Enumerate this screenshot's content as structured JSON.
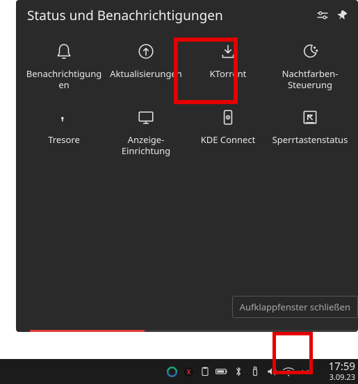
{
  "panel": {
    "title": "Status und Benachrichtigungen",
    "items": [
      {
        "label": "Benachrichtigungen",
        "name": "tile-notifications",
        "icon": "bell-icon"
      },
      {
        "label": "Aktualisierungen",
        "name": "tile-updates",
        "icon": "update-icon"
      },
      {
        "label": "KTorrent",
        "name": "tile-ktorrent",
        "icon": "download-icon"
      },
      {
        "label": "Nachtfarben-Steuerung",
        "name": "tile-nightcolor",
        "icon": "nightcolor-icon"
      },
      {
        "label": "Tresore",
        "name": "tile-vaults",
        "icon": "vault-icon"
      },
      {
        "label": "Anzeige-Einrichtung",
        "name": "tile-display",
        "icon": "display-icon"
      },
      {
        "label": "KDE Connect",
        "name": "tile-kdeconnect",
        "icon": "phone-icon"
      },
      {
        "label": "Sperrtastenstatus",
        "name": "tile-lockkeys",
        "icon": "keylock-icon"
      }
    ]
  },
  "tooltip": "Aufklappfenster schließen",
  "clock": {
    "time": "17:59",
    "date": "3.09.23"
  },
  "tray": [
    {
      "name": "tray-donut-icon"
    },
    {
      "name": "tray-x-red-icon"
    },
    {
      "name": "tray-clipboard-icon"
    },
    {
      "name": "tray-battery-icon"
    },
    {
      "name": "tray-bluetooth-icon"
    },
    {
      "name": "tray-usb-icon"
    },
    {
      "name": "tray-volume-icon"
    },
    {
      "name": "tray-wifi-icon"
    },
    {
      "name": "tray-chevron-down-icon"
    }
  ]
}
